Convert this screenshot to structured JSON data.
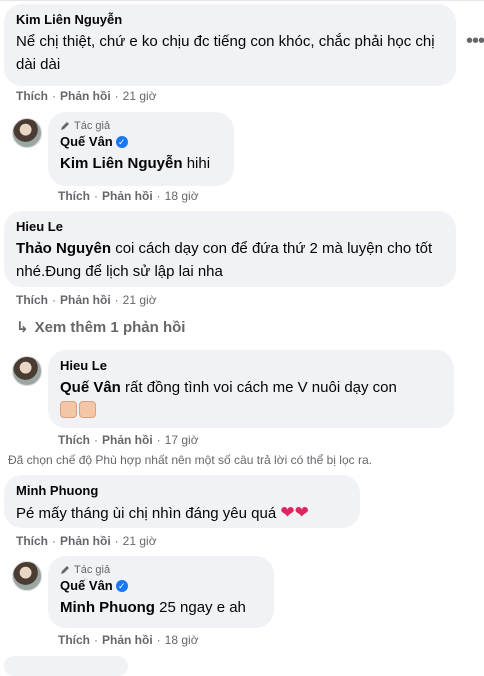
{
  "comments": [
    {
      "author": "Kim Liên Nguyễn",
      "text": "Nể chị thiệt, chứ e ko chịu đc tiếng con khóc, chắc phải học chị dài dài",
      "like": "Thích",
      "reply": "Phản hồi",
      "time": "21 giờ"
    },
    {
      "author_tag": "Tác giả",
      "author": "Quế Vân",
      "mention": "Kim Liên Nguyễn",
      "text": "hihi",
      "like": "Thích",
      "reply": "Phản hồi",
      "time": "18 giờ"
    },
    {
      "author": "Hieu Le",
      "mention": "Thảo Nguyên",
      "text": "coi cách dạy con để đứa thứ 2 mà luyện cho tốt nhé.Đung để lịch sử lập lai nha",
      "like": "Thích",
      "reply": "Phản hồi",
      "time": "21 giờ"
    },
    {
      "author": "Hieu Le",
      "mention": "Quế Vân",
      "text": "rất đồng tình voi cách me V nuôi dạy con",
      "like": "Thích",
      "reply": "Phản hồi",
      "time": "17 giờ"
    },
    {
      "author": "Minh Phuong",
      "text": "Pé mấy tháng ùi chị nhìn đáng yêu quá",
      "like": "Thích",
      "reply": "Phản hồi",
      "time": "21 giờ"
    },
    {
      "author_tag": "Tác giả",
      "author": "Quế Vân",
      "mention": "Minh Phuong",
      "text": "25 ngay e ah",
      "like": "Thích",
      "reply": "Phản hồi",
      "time": "18 giờ"
    }
  ],
  "see_more": "Xem thêm 1 phản hồi",
  "filter_notice": "Đã chọn chế độ Phù hợp nhất nên một số câu trả lời có thể bị lọc ra.",
  "icons": [
    "more-options-icon",
    "pencil-icon",
    "verified-badge-icon",
    "reply-arrow-icon",
    "thumbs-up-emoji-icon",
    "heart-emoji-icon"
  ]
}
